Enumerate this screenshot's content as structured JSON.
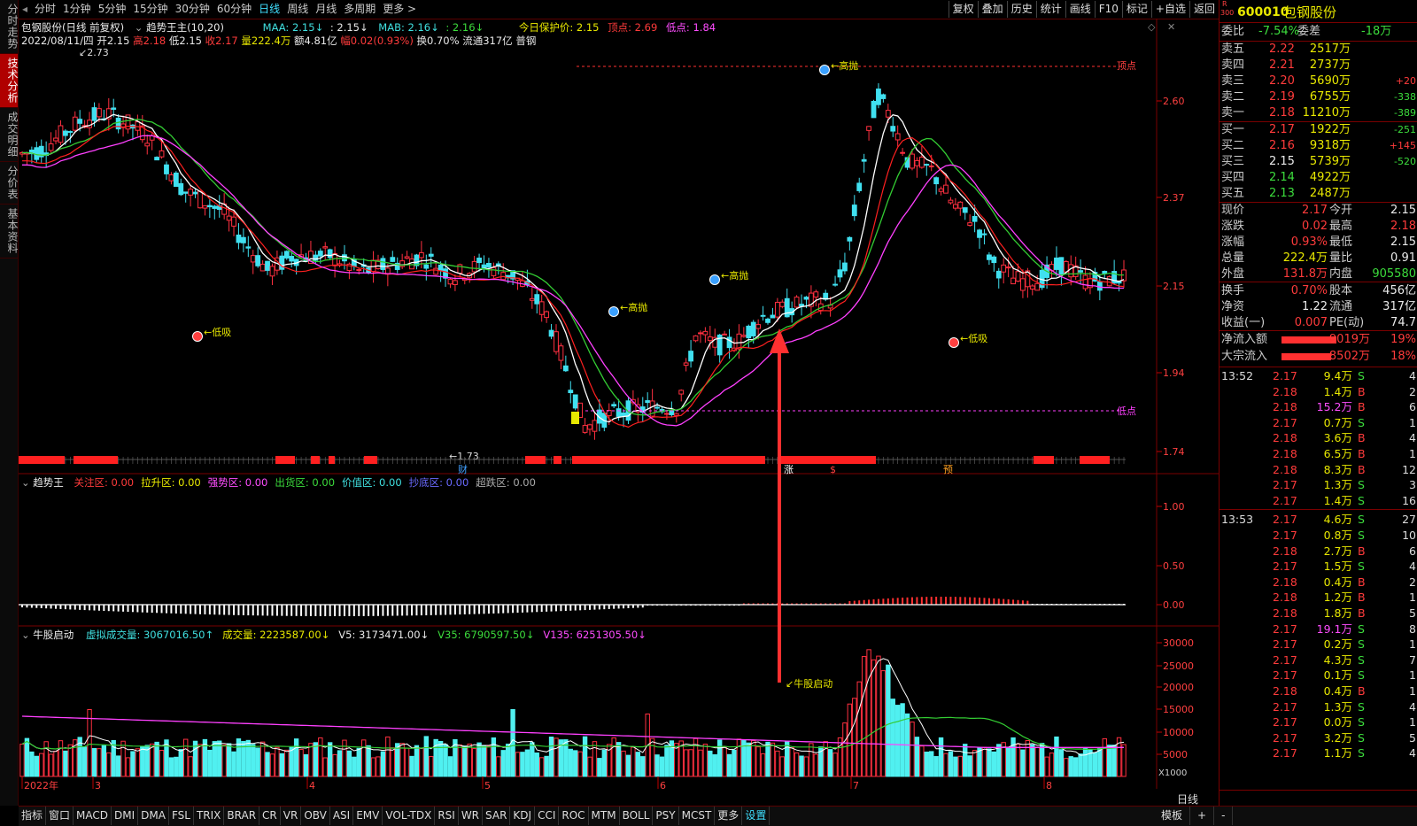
{
  "left_tabs": [
    {
      "label": "分时走势",
      "active": false
    },
    {
      "label": "技术分析",
      "active": true
    },
    {
      "label": "成交明细",
      "active": false
    },
    {
      "label": "分价表",
      "active": false
    },
    {
      "label": "基本资料",
      "active": false
    }
  ],
  "toolbar": {
    "periods": [
      "分时",
      "1分钟",
      "5分钟",
      "15分钟",
      "30分钟",
      "60分钟",
      "日线",
      "周线",
      "月线",
      "多周期",
      "更多 >"
    ],
    "active_period": "日线",
    "right_buttons": [
      "复权",
      "叠加",
      "历史",
      "统计",
      "画线",
      "F10",
      "标记",
      "+自选",
      "返回"
    ]
  },
  "chart": {
    "header_stock": "包钢股份(日线 前复权)",
    "header_indicator": "趋势王主(10,20)",
    "maa": "MAA: 2.15↓",
    "ma2": ": 2.15↓",
    "mab": "MAB: 2.16↓",
    "ma3": ": 2.16↓",
    "protect": "今日保护价: 2.15",
    "top_point": "顶点: 2.69",
    "low_point": "低点: 1.84",
    "date": "2022/08/11/四",
    "open": "开2.15",
    "high": "高2.18",
    "low": "低2.15",
    "close": "收2.17",
    "vol": "量222.4万",
    "amount": "额4.81亿",
    "change": "幅0.02(0.93%)",
    "turnover": "换0.70%",
    "float": "流通317亿",
    "sector": "普钢",
    "price_max": "2.73",
    "price_min": "1.73",
    "label_top": "顶点",
    "label_low": "低点",
    "annotations": [
      "高抛",
      "高抛",
      "高抛",
      "低吸",
      "低吸"
    ],
    "bar_labels": [
      "财",
      "涨",
      "$",
      "预"
    ],
    "y_ticks": [
      "2.60",
      "2.37",
      "2.15",
      "1.94",
      "1.74"
    ]
  },
  "ind1": {
    "name": "趋势王",
    "items": [
      {
        "label": "关注区: 0.00",
        "color": "#ff3b3b"
      },
      {
        "label": "拉升区: 0.00",
        "color": "#e8e800"
      },
      {
        "label": "强势区: 0.00",
        "color": "#ff4dff"
      },
      {
        "label": "出货区: 0.00",
        "color": "#3cdc3c"
      },
      {
        "label": "价值区: 0.00",
        "color": "#40e0e0"
      },
      {
        "label": "抄底区: 0.00",
        "color": "#6a6aff"
      },
      {
        "label": "超跌区: 0.00",
        "color": "#aaaaaa"
      }
    ],
    "y_ticks": [
      "1.00",
      "0.50",
      "0.00"
    ]
  },
  "ind2": {
    "name": "牛股启动",
    "items": [
      {
        "label": "虚拟成交量: 3067016.50↑",
        "color": "#40e0e0"
      },
      {
        "label": "成交量: 2223587.00↓",
        "color": "#e8e800"
      },
      {
        "label": "V5: 3173471.00↓",
        "color": "#eaeaea"
      },
      {
        "label": "V35: 6790597.50↓",
        "color": "#3cdc3c"
      },
      {
        "label": "V135: 6251305.50↓",
        "color": "#ff4dff"
      }
    ],
    "annotation": "牛股启动",
    "y_ticks": [
      "30000",
      "25000",
      "20000",
      "15000",
      "10000",
      "5000"
    ],
    "unit": "X1000",
    "month_labels": [
      "2022年",
      "3",
      "4",
      "5",
      "6",
      "7",
      "8"
    ]
  },
  "right_panel": {
    "code": "600010",
    "name": "包钢股份",
    "badge_top": "R",
    "badge_bot": "300",
    "weibi_label": "委比",
    "weibi": "-7.54%",
    "weicha_label": "委差",
    "weicha": "-18万",
    "sells": [
      {
        "label": "卖五",
        "price": "2.22",
        "vol": "2517万",
        "chg": ""
      },
      {
        "label": "卖四",
        "price": "2.21",
        "vol": "2737万",
        "chg": ""
      },
      {
        "label": "卖三",
        "price": "2.20",
        "vol": "5690万",
        "chg": "+20"
      },
      {
        "label": "卖二",
        "price": "2.19",
        "vol": "6755万",
        "chg": "-338"
      },
      {
        "label": "卖一",
        "price": "2.18",
        "vol": "11210万",
        "chg": "-389"
      }
    ],
    "buys": [
      {
        "label": "买一",
        "price": "2.17",
        "vol": "1922万",
        "chg": "-251"
      },
      {
        "label": "买二",
        "price": "2.16",
        "vol": "9318万",
        "chg": "+145"
      },
      {
        "label": "买三",
        "price": "2.15",
        "vol": "5739万",
        "chg": "-520"
      },
      {
        "label": "买四",
        "price": "2.14",
        "vol": "4922万",
        "chg": ""
      },
      {
        "label": "买五",
        "price": "2.13",
        "vol": "2487万",
        "chg": ""
      }
    ],
    "quote": [
      {
        "l": "现价",
        "v": "2.17",
        "l2": "今开",
        "v2": "2.15"
      },
      {
        "l": "涨跌",
        "v": "0.02",
        "l2": "最高",
        "v2": "2.18"
      },
      {
        "l": "涨幅",
        "v": "0.93%",
        "l2": "最低",
        "v2": "2.15"
      },
      {
        "l": "总量",
        "v": "222.4万",
        "l2": "量比",
        "v2": "0.91"
      },
      {
        "l": "外盘",
        "v": "131.8万",
        "l2": "内盘",
        "v2": "905580"
      }
    ],
    "quote2": [
      {
        "l": "换手",
        "v": "0.70%",
        "l2": "股本",
        "v2": "456亿"
      },
      {
        "l": "净资",
        "v": "1.22",
        "l2": "流通",
        "v2": "317亿"
      },
      {
        "l": "收益(一)",
        "v": "0.007",
        "l2": "PE(动)",
        "v2": "74.7"
      }
    ],
    "flows": [
      {
        "label": "净流入额",
        "value": "9019万",
        "pct": "19%"
      },
      {
        "label": "大宗流入",
        "value": "8502万",
        "pct": "18%"
      }
    ],
    "ticks": [
      {
        "t": "13:52",
        "p": "2.17",
        "v": "9.4万",
        "s": "S",
        "n": "4"
      },
      {
        "t": "",
        "p": "2.18",
        "v": "1.4万",
        "s": "B",
        "n": "2"
      },
      {
        "t": "",
        "p": "2.18",
        "v": "15.2万",
        "s": "B",
        "n": "6"
      },
      {
        "t": "",
        "p": "2.17",
        "v": "0.7万",
        "s": "S",
        "n": "1"
      },
      {
        "t": "",
        "p": "2.18",
        "v": "3.6万",
        "s": "B",
        "n": "4"
      },
      {
        "t": "",
        "p": "2.18",
        "v": "6.5万",
        "s": "B",
        "n": "1"
      },
      {
        "t": "",
        "p": "2.18",
        "v": "8.3万",
        "s": "B",
        "n": "12"
      },
      {
        "t": "",
        "p": "2.17",
        "v": "1.3万",
        "s": "S",
        "n": "3"
      },
      {
        "t": "",
        "p": "2.17",
        "v": "1.4万",
        "s": "S",
        "n": "16"
      },
      {
        "t": "13:53",
        "p": "2.17",
        "v": "4.6万",
        "s": "S",
        "n": "27"
      },
      {
        "t": "",
        "p": "2.17",
        "v": "0.8万",
        "s": "S",
        "n": "10"
      },
      {
        "t": "",
        "p": "2.18",
        "v": "2.7万",
        "s": "B",
        "n": "6"
      },
      {
        "t": "",
        "p": "2.17",
        "v": "1.5万",
        "s": "S",
        "n": "4"
      },
      {
        "t": "",
        "p": "2.18",
        "v": "0.4万",
        "s": "B",
        "n": "2"
      },
      {
        "t": "",
        "p": "2.18",
        "v": "1.2万",
        "s": "B",
        "n": "1"
      },
      {
        "t": "",
        "p": "2.18",
        "v": "1.8万",
        "s": "B",
        "n": "5"
      },
      {
        "t": "",
        "p": "2.17",
        "v": "19.1万",
        "s": "S",
        "n": "8"
      },
      {
        "t": "",
        "p": "2.17",
        "v": "0.2万",
        "s": "S",
        "n": "1"
      },
      {
        "t": "",
        "p": "2.17",
        "v": "4.3万",
        "s": "S",
        "n": "7"
      },
      {
        "t": "",
        "p": "2.17",
        "v": "0.1万",
        "s": "S",
        "n": "1"
      },
      {
        "t": "",
        "p": "2.18",
        "v": "0.4万",
        "s": "B",
        "n": "1"
      },
      {
        "t": "",
        "p": "2.17",
        "v": "1.3万",
        "s": "S",
        "n": "4"
      },
      {
        "t": "",
        "p": "2.17",
        "v": "0.0万",
        "s": "S",
        "n": "1"
      },
      {
        "t": "",
        "p": "2.17",
        "v": "3.2万",
        "s": "S",
        "n": "5"
      },
      {
        "t": "",
        "p": "2.17",
        "v": "1.1万",
        "s": "S",
        "n": "4"
      }
    ],
    "bottom_btn": "日线"
  },
  "bottom_tabs": [
    "指标",
    "窗口",
    "MACD",
    "DMI",
    "DMA",
    "FSL",
    "TRIX",
    "BRAR",
    "CR",
    "VR",
    "OBV",
    "ASI",
    "EMV",
    "VOL-TDX",
    "RSI",
    "WR",
    "SAR",
    "KDJ",
    "CCI",
    "ROC",
    "MTM",
    "BOLL",
    "PSY",
    "MCST",
    "更多",
    "设置"
  ],
  "bottom_right": [
    "模板",
    "+",
    "-"
  ],
  "colors": {
    "up": "#ff3040",
    "down": "#40e0f0",
    "ma_fast": "#ffffff",
    "ma_green": "#33cc33",
    "ma_red": "#ff2020",
    "ma_magenta": "#ff40ff",
    "arrow": "#ff3030"
  }
}
